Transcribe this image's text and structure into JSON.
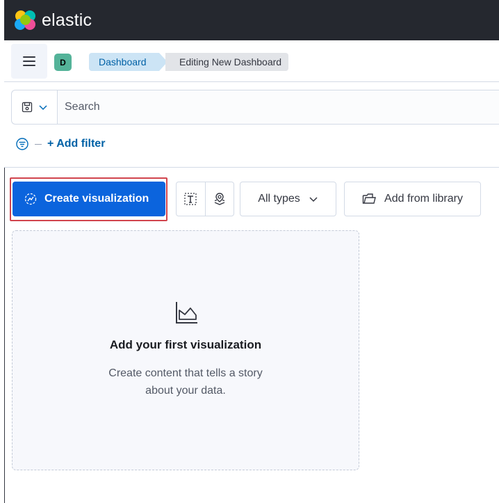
{
  "app": {
    "logo_text": "elastic",
    "logo_colors": [
      "#f04e98",
      "#fec514",
      "#00bfb3",
      "#1ba9f5",
      "#93c90e"
    ]
  },
  "breadcrumbs": {
    "space_initial": "D",
    "space_color": "#54b399",
    "items": [
      "Dashboard",
      "Editing New Dashboard"
    ]
  },
  "query": {
    "search_placeholder": "Search",
    "add_filter_label": "+ Add filter"
  },
  "toolbar": {
    "create_label": "Create visualization",
    "types_label": "All types",
    "library_label": "Add from library",
    "accent": "#0b64dd",
    "highlight": "#d1444d"
  },
  "empty_state": {
    "title": "Add your first visualization",
    "body_line1": "Create content that tells a story",
    "body_line2": "about your data."
  }
}
